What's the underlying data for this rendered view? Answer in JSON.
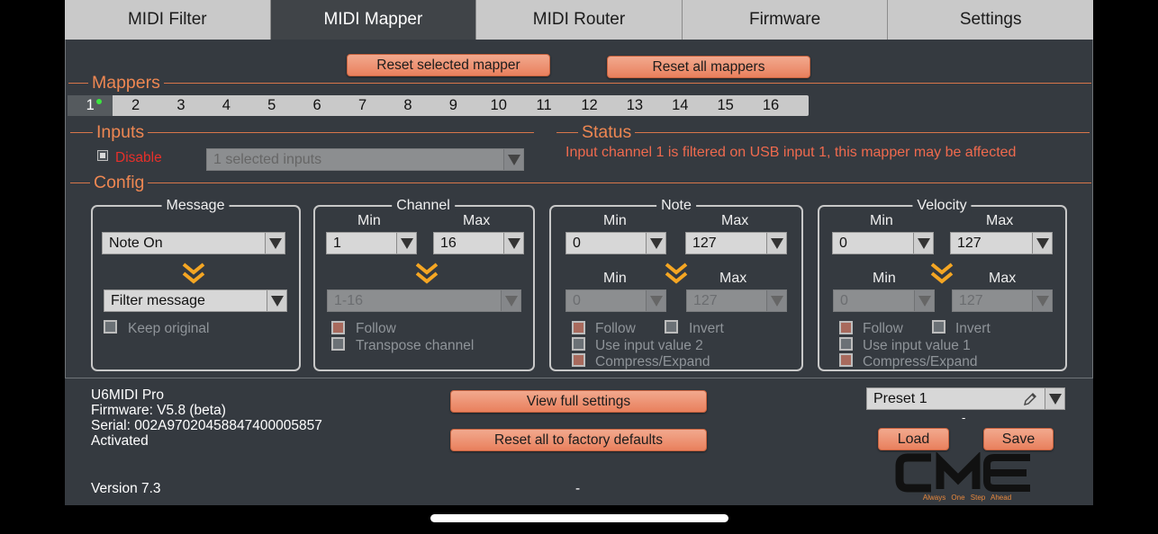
{
  "tabs": [
    "MIDI Filter",
    "MIDI Mapper",
    "MIDI Router",
    "Firmware",
    "Settings"
  ],
  "buttons": {
    "reset_selected": "Reset selected mapper",
    "reset_all": "Reset all mappers",
    "view_settings": "View full settings",
    "factory": "Reset all to factory defaults",
    "load": "Load",
    "save": "Save"
  },
  "sections": {
    "mappers": "Mappers",
    "inputs": "Inputs",
    "status": "Status",
    "config": "Config"
  },
  "mappers": [
    "1",
    "2",
    "3",
    "4",
    "5",
    "6",
    "7",
    "8",
    "9",
    "10",
    "11",
    "12",
    "13",
    "14",
    "15",
    "16"
  ],
  "inputs": {
    "disable_label": "Disable",
    "selected": "1 selected inputs"
  },
  "status_text": "Input channel 1 is filtered on USB input 1, this mapper may be affected",
  "message": {
    "title": "Message",
    "type": "Note On",
    "action": "Filter message",
    "keep_original": "Keep original"
  },
  "channel": {
    "title": "Channel",
    "min_label": "Min",
    "max_label": "Max",
    "min": "1",
    "max": "16",
    "out": "1-16",
    "follow": "Follow",
    "transpose": "Transpose channel"
  },
  "note": {
    "title": "Note",
    "min_label": "Min",
    "max_label": "Max",
    "min": "0",
    "max": "127",
    "out_min": "0",
    "out_max": "127",
    "follow": "Follow",
    "invert": "Invert",
    "use_input": "Use input value 2",
    "compress": "Compress/Expand"
  },
  "velocity": {
    "title": "Velocity",
    "min_label": "Min",
    "max_label": "Max",
    "min": "0",
    "max": "127",
    "out_min": "0",
    "out_max": "127",
    "follow": "Follow",
    "invert": "Invert",
    "use_input": "Use input value 1",
    "compress": "Compress/Expand"
  },
  "device": {
    "name": "U6MIDI Pro",
    "firmware": "Firmware: V5.8 (beta)",
    "serial": "Serial: 002A97020458847400005857",
    "activated": "Activated",
    "version": "Version 7.3"
  },
  "preset": {
    "selected": "Preset 1",
    "dash": "-"
  },
  "footer_dash": "-",
  "logo": {
    "text": "CME",
    "tagline": "Always One Step Ahead"
  },
  "colors": {
    "accent": "#ee8752",
    "status": "#ef6a4e",
    "disable": "#e8302a",
    "active_dot": "#3ce640"
  }
}
